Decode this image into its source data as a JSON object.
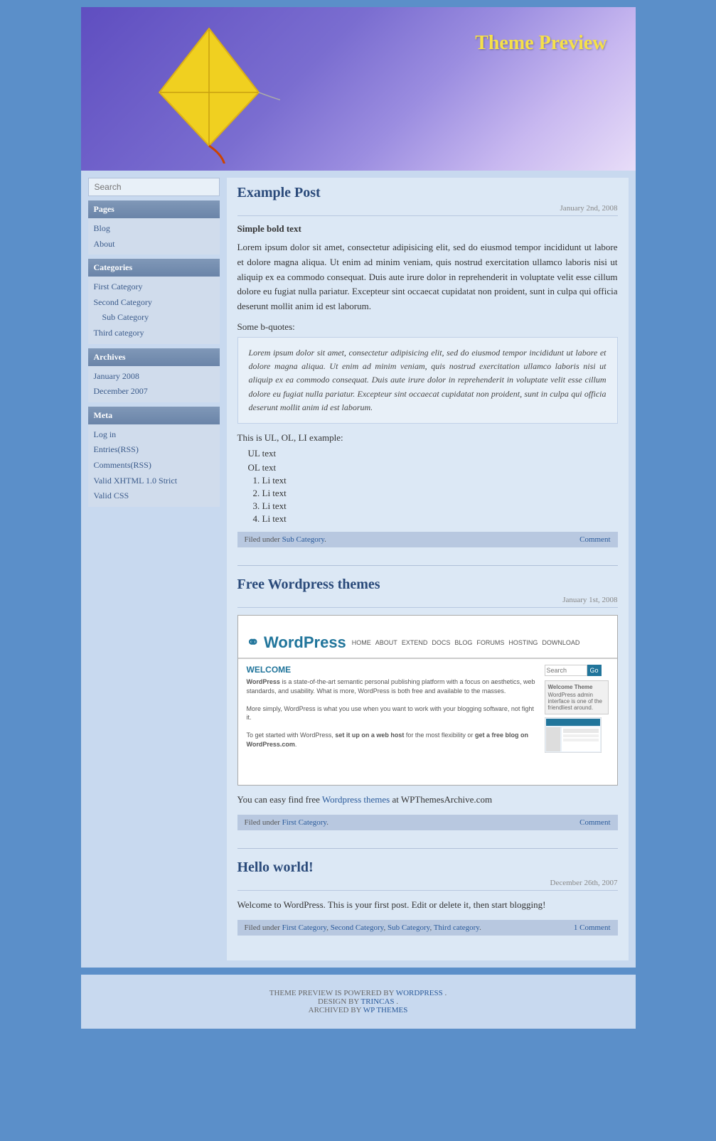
{
  "header": {
    "title": "Theme Preview",
    "bg_color": "#6a5cc8"
  },
  "sidebar": {
    "search_placeholder": "Search",
    "pages_heading": "Pages",
    "pages_links": [
      "Blog",
      "About"
    ],
    "categories_heading": "Categories",
    "categories": [
      {
        "label": "First Category",
        "indent": false
      },
      {
        "label": "Second Category",
        "indent": false
      },
      {
        "label": "Sub Category",
        "indent": true
      },
      {
        "label": "Third category",
        "indent": false
      }
    ],
    "archives_heading": "Archives",
    "archives": [
      "January 2008",
      "December 2007"
    ],
    "meta_heading": "Meta",
    "meta_links": [
      "Log in",
      "Entries(RSS)",
      "Comments(RSS)",
      "Valid XHTML 1.0 Strict",
      "Valid CSS"
    ]
  },
  "posts": [
    {
      "title": "Example Post",
      "date": "January 2nd, 2008",
      "subtitle": "Simple bold text",
      "body": "Lorem ipsum dolor sit amet, consectetur adipisicing elit, sed do eiusmod tempor incididunt ut labore et dolore magna aliqua. Ut enim ad minim veniam, quis nostrud exercitation ullamco laboris nisi ut aliquip ex ea commodo consequat. Duis aute irure dolor in reprehenderit in voluptate velit esse cillum dolore eu fugiat nulla pariatur. Excepteur sint occaecat cupidatat non proident, sunt in culpa qui officia deserunt mollit anim id est laborum.",
      "blockquote_label": "Some b-quotes:",
      "blockquote": "Lorem ipsum dolor sit amet, consectetur adipisicing elit, sed do eiusmod tempor incididunt ut labore et dolore magna aliqua. Ut enim ad minim veniam, quis nostrud exercitation ullamco laboris nisi ut aliquip ex ea commodo consequat. Duis aute irure dolor in reprehenderit in voluptate velit esse cillum dolore eu fugiat nulla pariatur. Excepteur sint occaecat cupidatat non proident, sunt in culpa qui officia deserunt mollit anim id est laborum.",
      "list_label": "This is UL, OL, LI example:",
      "ul_text": "UL text",
      "ol_text": "OL text",
      "li_items": [
        "Li text",
        "Li text",
        "Li text",
        "Li text"
      ],
      "filed_under": "Filed under",
      "category_link": "Sub Category",
      "comment_link": "Comment"
    },
    {
      "title": "Free Wordpress themes",
      "date": "January 1st, 2008",
      "free_text": "You can easy find free",
      "wp_link_text": "Wordpress themes",
      "wp_link_suffix": " at WPThemesArchive.com",
      "filed_under": "Filed under",
      "category_link": "First Category",
      "comment_link": "Comment"
    },
    {
      "title": "Hello world!",
      "date": "December 26th, 2007",
      "body": "Welcome to WordPress. This is your first post. Edit or delete it, then start blogging!",
      "filed_under": "Filed under",
      "category_links": [
        "First Category",
        "Second Category",
        "Sub Category",
        "Third category"
      ],
      "comment_link": "1 Comment"
    }
  ],
  "footer": {
    "line1_prefix": "THEME PREVIEW IS POWERED BY",
    "wordpress_link": "WORDPRESS",
    "line1_suffix": ".",
    "line2_prefix": "DESIGN BY",
    "trincas_link": "TRINCAS",
    "line2_suffix": ".",
    "line3_prefix": "ARCHIVED BY",
    "wpthemes_link": "WP THEMES"
  }
}
